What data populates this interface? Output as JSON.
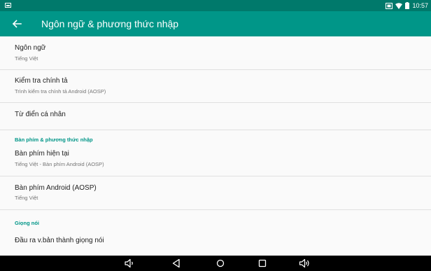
{
  "status_bar": {
    "time": "10:57",
    "icons": [
      "image-icon",
      "cast-icon",
      "wifi-icon",
      "battery-icon"
    ]
  },
  "app_bar": {
    "title": "Ngôn ngữ & phương thức nhập",
    "back_icon": "arrow-back-icon"
  },
  "items": {
    "language": {
      "title": "Ngôn ngữ",
      "subtitle": "Tiếng Việt"
    },
    "spell_check": {
      "title": "Kiểm tra chính tả",
      "subtitle": "Trình kiểm tra chính tả Android (AOSP)"
    },
    "personal_dictionary": {
      "title": "Từ điển cá nhân"
    },
    "current_keyboard": {
      "title": "Bàn phím hiện tại",
      "subtitle": "Tiếng Việt - Bàn phím Android (AOSP)"
    },
    "android_keyboard": {
      "title": "Bàn phím Android (AOSP)",
      "subtitle": "Tiếng Việt"
    },
    "tts_output": {
      "title": "Đầu ra v.bản thành giọng nói"
    }
  },
  "sections": {
    "keyboard": "Bàn phím & phương thức nhập",
    "speech": "Giọng nói"
  },
  "nav_bar": {
    "icons": [
      "volume-down-icon",
      "back-icon",
      "home-icon",
      "recents-icon",
      "volume-up-icon"
    ]
  },
  "colors": {
    "status_bar": "#00796b",
    "app_bar": "#009688",
    "accent": "#009688",
    "background": "#fafafa",
    "nav_bar": "#000000"
  }
}
